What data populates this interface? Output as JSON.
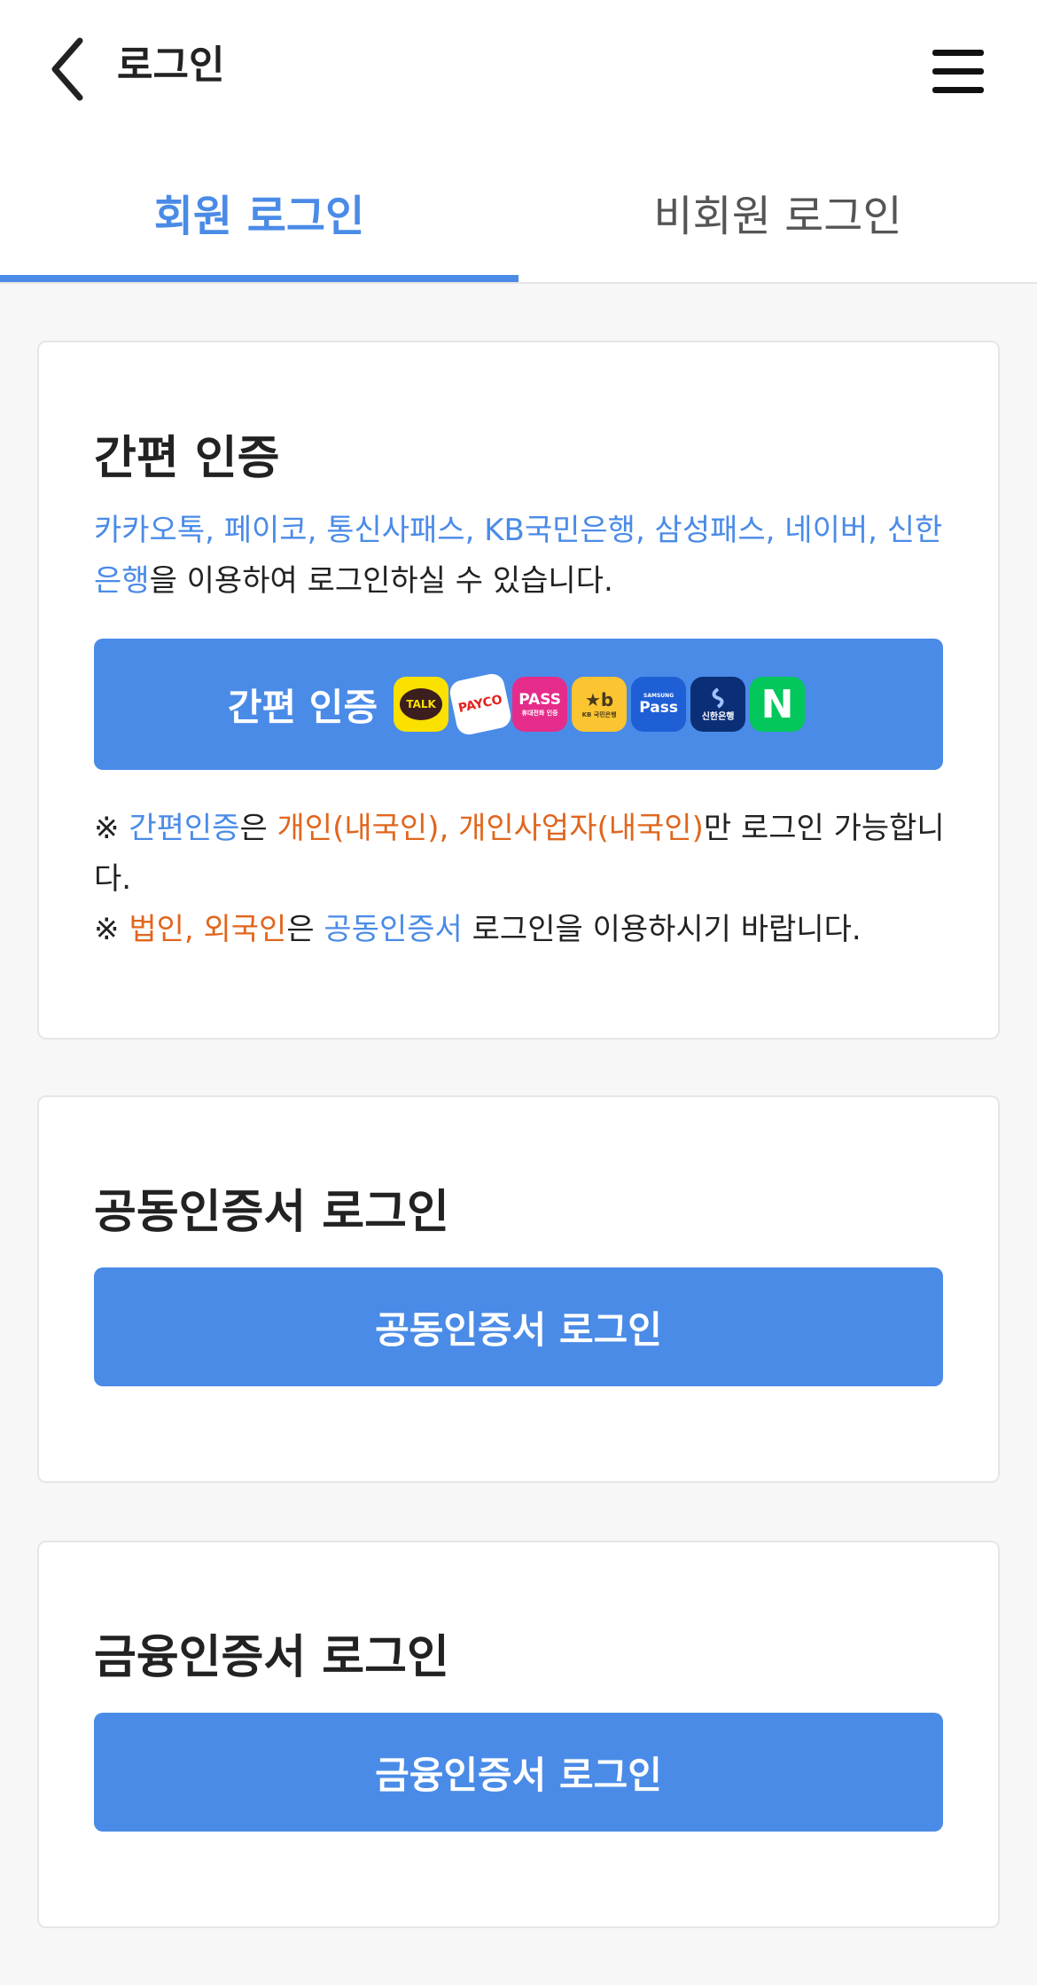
{
  "header": {
    "title": "로그인"
  },
  "tabs": [
    {
      "label": "회원 로그인",
      "active": true
    },
    {
      "label": "비회원 로그인",
      "active": false
    }
  ],
  "simple_auth": {
    "title": "간편 인증",
    "desc_providers": "카카오톡, 페이코, 통신사패스, KB국민은행, 삼성패스, 네이버, 신한은행",
    "desc_suffix": "을 이용하여 로그인하실 수 있습니다.",
    "button_label": "간편 인증",
    "provider_icons": [
      {
        "name": "kakaotalk-icon",
        "text": "TALK",
        "bg": "#fae100",
        "fg": "#3c1e1e"
      },
      {
        "name": "payco-icon",
        "text": "PAYCO",
        "bg": "#ffffff",
        "fg": "#e5211c"
      },
      {
        "name": "pass-icon",
        "text": "PASS",
        "sub": "휴대전화 인증",
        "bg": "#e52c8a",
        "fg": "#ffffff"
      },
      {
        "name": "kb-bank-icon",
        "text": "★b",
        "sub": "KB 국민은행",
        "bg": "#fbc531",
        "fg": "#4a3b1e"
      },
      {
        "name": "samsung-pass-icon",
        "text": "Pass",
        "sub_top": "SAMSUNG",
        "bg": "#1f5fd6",
        "fg": "#ffffff"
      },
      {
        "name": "shinhan-bank-icon",
        "text": "신한은행",
        "bg": "#0b2f77",
        "fg": "#ffffff"
      },
      {
        "name": "naver-icon",
        "text": "N",
        "bg": "#03c75a",
        "fg": "#ffffff"
      }
    ],
    "notes": {
      "mark": "※",
      "n1_blue": "간편인증",
      "n1_a": "은 ",
      "n1_orange": "개인(내국인), 개인사업자(내국인)",
      "n1_b": "만 로그인 가능합니다.",
      "n2_orange": "법인, 외국인",
      "n2_a": "은 ",
      "n2_blue": "공동인증서",
      "n2_b": " 로그인을 이용하시기 바랍니다."
    }
  },
  "joint_cert": {
    "title": "공동인증서 로그인",
    "button_label": "공동인증서 로그인"
  },
  "finance_cert": {
    "title": "금융인증서 로그인",
    "button_label": "금융인증서 로그인"
  },
  "colors": {
    "accent": "#4a8be7",
    "warning": "#e0661e"
  }
}
